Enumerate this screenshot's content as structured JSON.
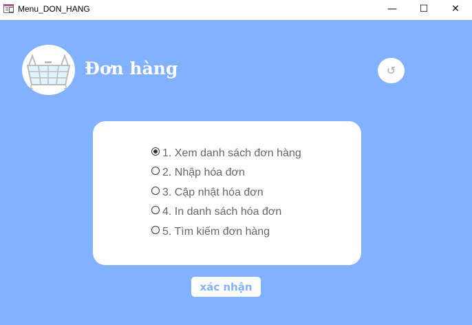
{
  "window": {
    "title": "Menu_DON_HANG",
    "minimize": "—",
    "maximize": "☐",
    "close": "✕"
  },
  "header": {
    "title": "Đơn hàng",
    "back_icon": "↺"
  },
  "options": [
    {
      "label": "1. Xem danh sách đơn hàng",
      "selected": true
    },
    {
      "label": "2. Nhập hóa đơn",
      "selected": false
    },
    {
      "label": "3. Cập nhật hóa đơn",
      "selected": false
    },
    {
      "label": "4. In danh sách hóa đơn",
      "selected": false
    },
    {
      "label": "5. Tìm kiếm đơn hàng",
      "selected": false
    }
  ],
  "confirm_label": "xác nhận",
  "colors": {
    "background": "#82b1ff",
    "card": "#ffffff"
  }
}
